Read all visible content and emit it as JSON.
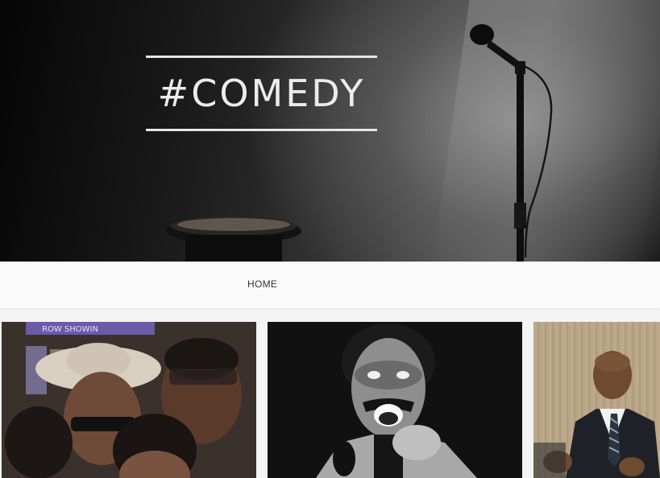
{
  "hero": {
    "title": "#COMEDY",
    "icons": [
      "microphone-icon",
      "stool-icon"
    ]
  },
  "nav": {
    "items": [
      {
        "label": "HOME"
      }
    ]
  },
  "gallery": {
    "cards": [
      {
        "image": "friends-selfie-gif",
        "sign_text": "ROW SHOWIN"
      },
      {
        "image": "comedian-on-stage-gif"
      },
      {
        "image": "man-in-suit-at-podium-gif"
      }
    ]
  },
  "colors": {
    "hero_text": "#ececec",
    "nav_bg": "#fafafa",
    "nav_text": "#333333"
  }
}
